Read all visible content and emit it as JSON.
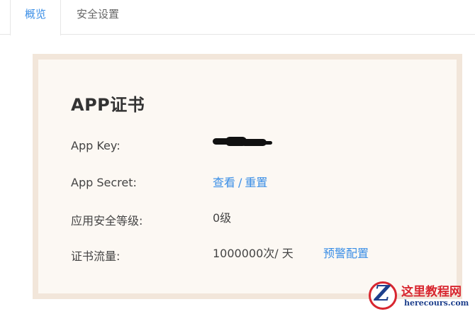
{
  "tabs": [
    {
      "label": "概览",
      "active": true
    },
    {
      "label": "安全设置",
      "active": false
    }
  ],
  "card": {
    "title": "APP证书",
    "rows": {
      "app_key": {
        "label": "App Key:",
        "value": ""
      },
      "app_secret": {
        "label": "App Secret:",
        "view_link": "查看",
        "separator": "/",
        "reset_link": "重置"
      },
      "security_level": {
        "label": "应用安全等级:",
        "value": "0级"
      },
      "cert_traffic": {
        "label": "证书流量:",
        "value": "1000000次/ 天",
        "alert_link": "预警配置"
      }
    }
  },
  "watermark": {
    "title": "这里教程网",
    "url": "herecours.com"
  },
  "colors": {
    "accent": "#3a8ee6",
    "card_border": "#f2e6da",
    "card_bg": "#fcf8f3",
    "watermark_red": "#d8262f",
    "watermark_blue": "#1d3f8c"
  }
}
